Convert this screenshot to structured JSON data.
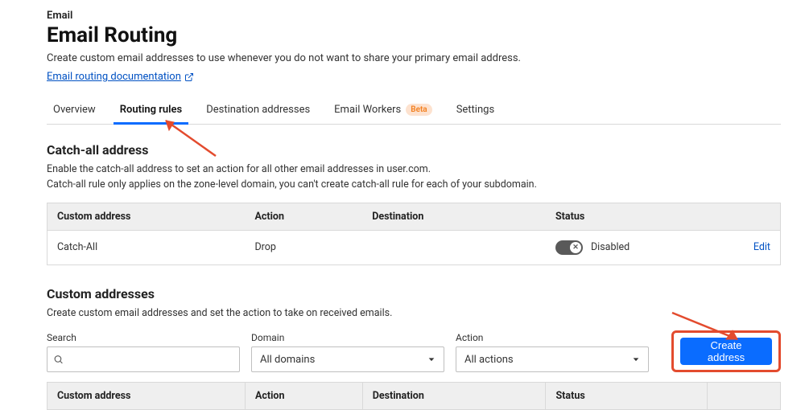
{
  "header": {
    "crumb": "Email",
    "title": "Email Routing",
    "description": "Create custom email addresses to use whenever you do not want to share your primary email address.",
    "doc_link": "Email routing documentation"
  },
  "tabs": {
    "items": [
      {
        "label": "Overview",
        "active": false
      },
      {
        "label": "Routing rules",
        "active": true
      },
      {
        "label": "Destination addresses",
        "active": false
      },
      {
        "label": "Email Workers",
        "active": false,
        "badge": "Beta"
      },
      {
        "label": "Settings",
        "active": false
      }
    ]
  },
  "catch_all": {
    "heading": "Catch-all address",
    "sub1": "Enable the catch-all address to set an action for all other email addresses in user.com.",
    "sub2": "Catch-all rule only applies on the zone-level domain, you can't create catch-all rule for each of your subdomain.",
    "columns": {
      "addr": "Custom address",
      "action": "Action",
      "dest": "Destination",
      "status": "Status"
    },
    "row": {
      "addr": "Catch-All",
      "action": "Drop",
      "dest": "",
      "status_label": "Disabled",
      "edit": "Edit"
    }
  },
  "custom": {
    "heading": "Custom addresses",
    "sub": "Create custom email addresses and set the action to take on received emails.",
    "filters": {
      "search_label": "Search",
      "domain_label": "Domain",
      "domain_value": "All domains",
      "action_label": "Action",
      "action_value": "All actions"
    },
    "create_label": "Create address",
    "columns": {
      "addr": "Custom address",
      "action": "Action",
      "dest": "Destination",
      "status": "Status"
    }
  }
}
